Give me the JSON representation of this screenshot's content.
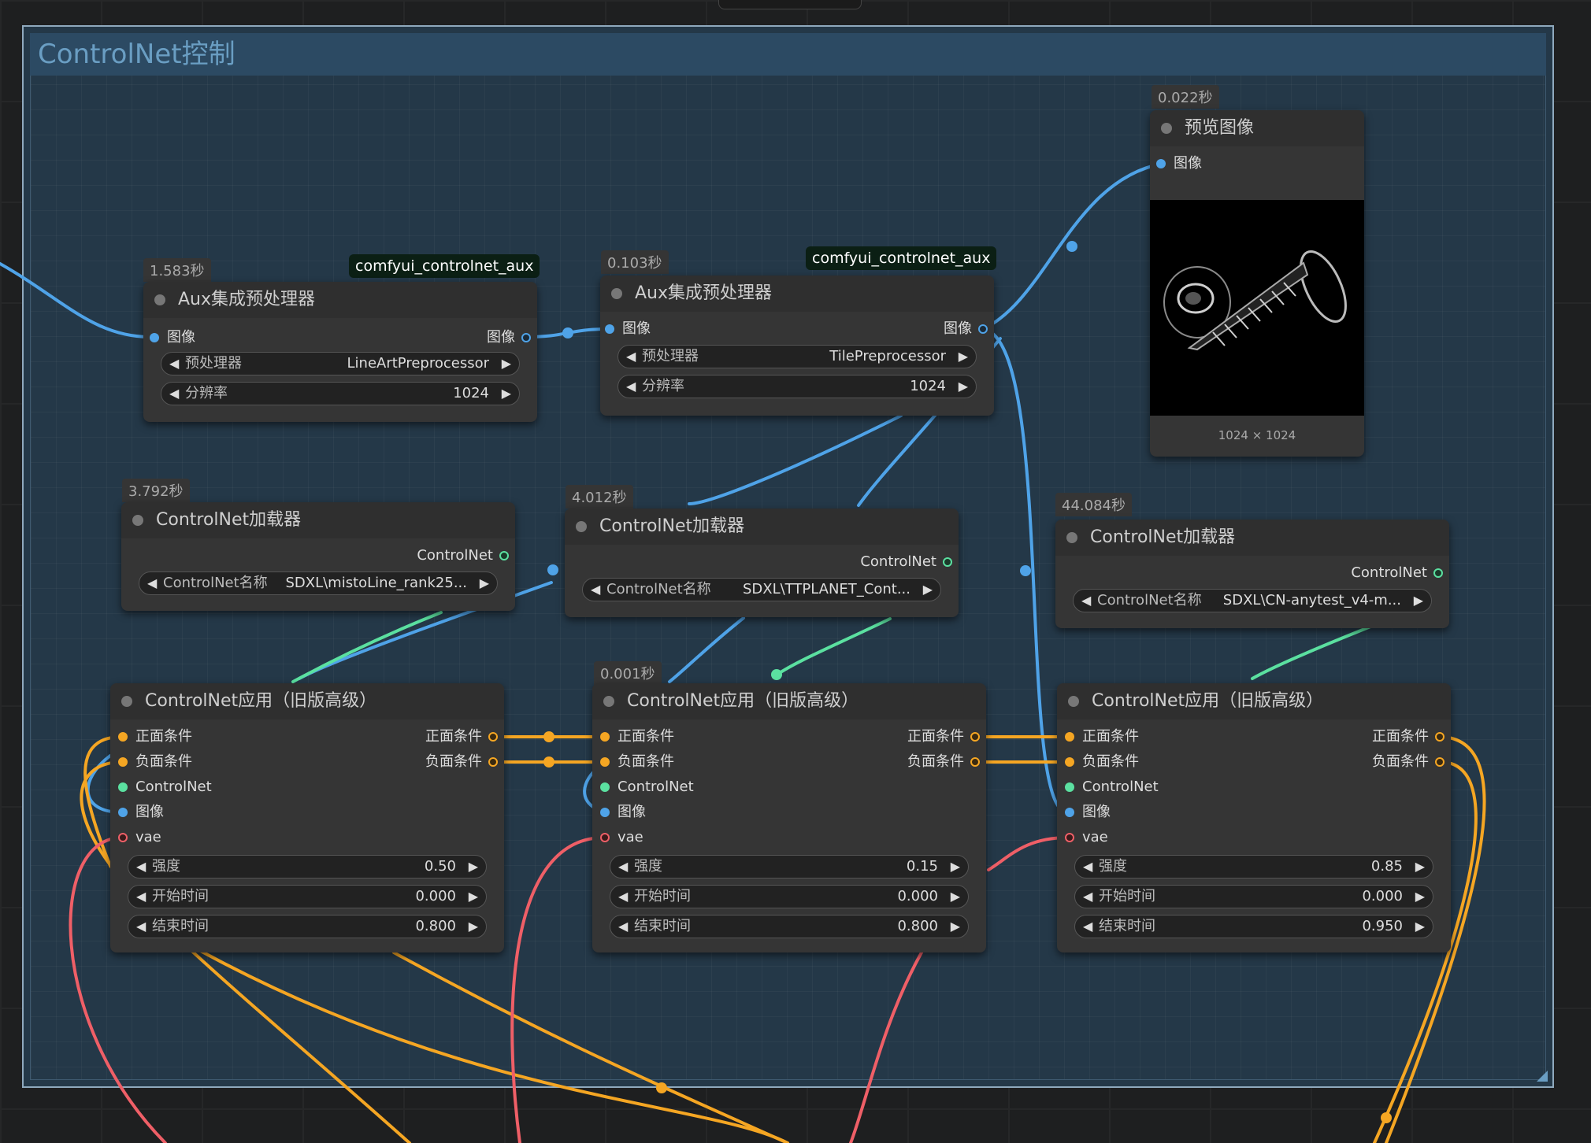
{
  "group": {
    "title": "ControlNet控制"
  },
  "colors": {
    "image_wire": "#4fa3e8",
    "controlnet_wire": "#5be0a0",
    "conditioning_wire": "#f5a623",
    "vae_wire": "#ef5f67"
  },
  "aux1": {
    "time": "1.583秒",
    "badge": "comfyui_controlnet_aux",
    "title": "Aux集成预处理器",
    "input": "图像",
    "output": "图像",
    "w1_label": "预处理器",
    "w1_value": "LineArtPreprocessor",
    "w2_label": "分辨率",
    "w2_value": "1024"
  },
  "aux2": {
    "time": "0.103秒",
    "badge": "comfyui_controlnet_aux",
    "title": "Aux集成预处理器",
    "input": "图像",
    "output": "图像",
    "w1_label": "预处理器",
    "w1_value": "TilePreprocessor",
    "w2_label": "分辨率",
    "w2_value": "1024"
  },
  "preview": {
    "time": "0.022秒",
    "title": "预览图像",
    "input": "图像",
    "size_label": "1024 × 1024"
  },
  "loader1": {
    "time": "3.792秒",
    "title": "ControlNet加载器",
    "output": "ControlNet",
    "w_label": "ControlNet名称",
    "w_value": "SDXL\\mistoLine_rank25..."
  },
  "loader2": {
    "time": "4.012秒",
    "title": "ControlNet加载器",
    "output": "ControlNet",
    "w_label": "ControlNet名称",
    "w_value": "SDXL\\TTPLANET_Cont..."
  },
  "loader3": {
    "time": "44.084秒",
    "title": "ControlNet加载器",
    "output": "ControlNet",
    "w_label": "ControlNet名称",
    "w_value": "SDXL\\CN-anytest_v4-m..."
  },
  "apply1": {
    "time": "",
    "title": "ControlNet应用（旧版高级）",
    "inputs": [
      "正面条件",
      "负面条件",
      "ControlNet",
      "图像",
      "vae"
    ],
    "outputs": [
      "正面条件",
      "负面条件"
    ],
    "w1_label": "强度",
    "w1_value": "0.50",
    "w2_label": "开始时间",
    "w2_value": "0.000",
    "w3_label": "结束时间",
    "w3_value": "0.800"
  },
  "apply2": {
    "time": "0.001秒",
    "title": "ControlNet应用（旧版高级）",
    "inputs": [
      "正面条件",
      "负面条件",
      "ControlNet",
      "图像",
      "vae"
    ],
    "outputs": [
      "正面条件",
      "负面条件"
    ],
    "w1_label": "强度",
    "w1_value": "0.15",
    "w2_label": "开始时间",
    "w2_value": "0.000",
    "w3_label": "结束时间",
    "w3_value": "0.800"
  },
  "apply3": {
    "time": "",
    "title": "ControlNet应用（旧版高级）",
    "inputs": [
      "正面条件",
      "负面条件",
      "ControlNet",
      "图像",
      "vae"
    ],
    "outputs": [
      "正面条件",
      "负面条件"
    ],
    "w1_label": "强度",
    "w1_value": "0.85",
    "w2_label": "开始时间",
    "w2_value": "0.000",
    "w3_label": "结束时间",
    "w3_value": "0.950"
  }
}
